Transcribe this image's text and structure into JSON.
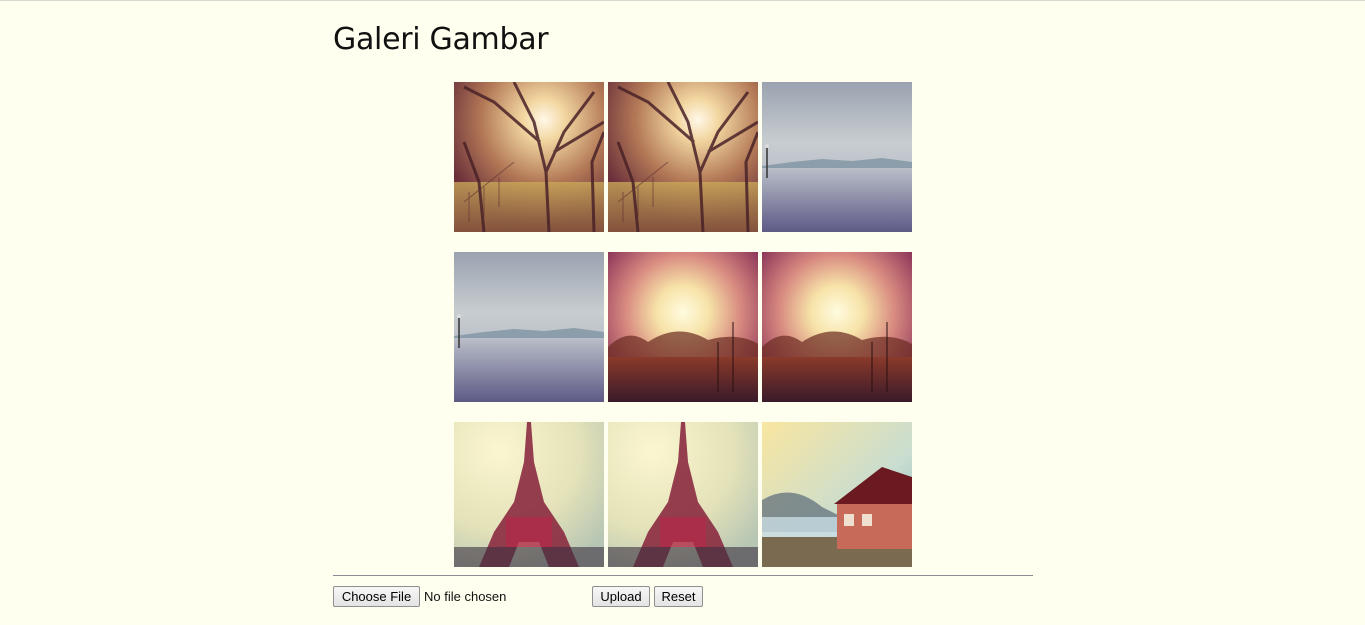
{
  "page": {
    "title": "Galeri Gambar"
  },
  "gallery": {
    "images": [
      {
        "name": "forest-sunlight"
      },
      {
        "name": "forest-sunlight"
      },
      {
        "name": "misty-lake"
      },
      {
        "name": "misty-lake"
      },
      {
        "name": "sunset-harbor"
      },
      {
        "name": "sunset-harbor"
      },
      {
        "name": "eiffel-tower"
      },
      {
        "name": "eiffel-tower"
      },
      {
        "name": "red-house-lakeside"
      }
    ]
  },
  "upload": {
    "choose_file_label": "Choose File",
    "file_status": "No file chosen",
    "upload_label": "Upload",
    "reset_label": "Reset"
  }
}
